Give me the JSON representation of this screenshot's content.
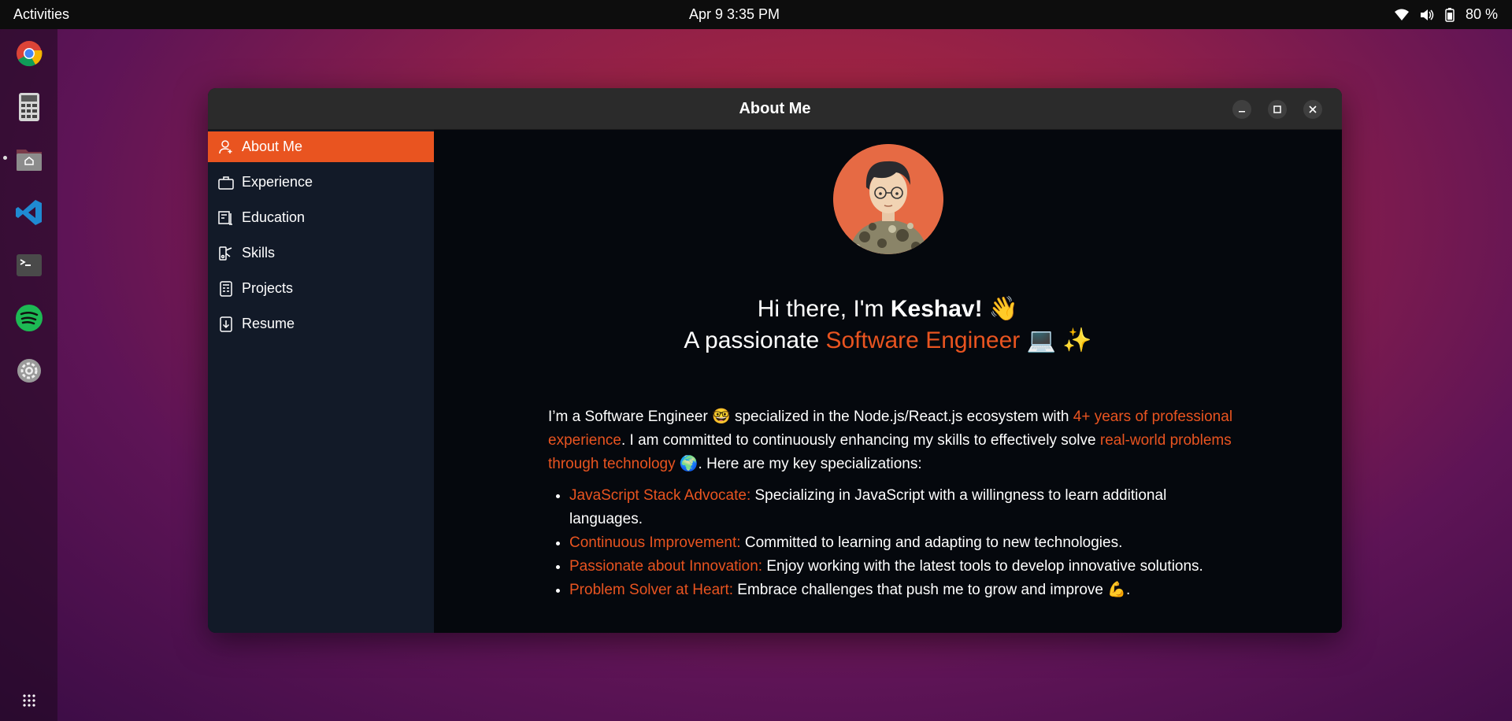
{
  "topbar": {
    "activities": "Activities",
    "clock": "Apr 9  3:35 PM",
    "battery": "80 %",
    "icons": [
      "wifi-icon",
      "volume-icon",
      "battery-icon"
    ]
  },
  "dock": {
    "apps": [
      "chrome-icon",
      "calculator-icon",
      "files-icon",
      "vscode-icon",
      "terminal-icon",
      "spotify-icon",
      "settings-icon",
      "app-grid-icon"
    ]
  },
  "window": {
    "title": "About Me"
  },
  "sidebar": {
    "items": [
      {
        "label": "About Me",
        "icon": "user-icon",
        "active": true
      },
      {
        "label": "Experience",
        "icon": "briefcase-icon",
        "active": false
      },
      {
        "label": "Education",
        "icon": "education-icon",
        "active": false
      },
      {
        "label": "Skills",
        "icon": "skills-icon",
        "active": false
      },
      {
        "label": "Projects",
        "icon": "projects-icon",
        "active": false
      },
      {
        "label": "Resume",
        "icon": "download-icon",
        "active": false
      }
    ]
  },
  "hero": {
    "greeting_prefix": "Hi there, I'm ",
    "name": "Keshav!",
    "wave": "👋",
    "line2_prefix": "A passionate ",
    "role": "Software Engineer",
    "emojis": "💻 ✨"
  },
  "bio": {
    "p1_a": "I’m a Software Engineer 🤓 specialized in the Node.js/React.js ecosystem with ",
    "p1_hl1": "4+ years of professional experience",
    "p1_b": ". I am committed to continuously enhancing my skills to effectively solve ",
    "p1_hl2": "real-world problems through technology",
    "p1_c": " 🌍. Here are my key specializations:",
    "points": [
      {
        "title": "JavaScript Stack Advocate:",
        "text": " Specializing in JavaScript with a willingness to learn additional languages."
      },
      {
        "title": "Continuous Improvement:",
        "text": " Committed to learning and adapting to new technologies."
      },
      {
        "title": "Passionate about Innovation:",
        "text": " Enjoy working with the latest tools to develop innovative solutions."
      },
      {
        "title": "Problem Solver at Heart:",
        "text": " Embrace challenges that push me to grow and improve 💪."
      }
    ]
  },
  "colors": {
    "accent": "#e95420",
    "window_bg": "#05080d",
    "sidebar_bg": "#121a28"
  }
}
